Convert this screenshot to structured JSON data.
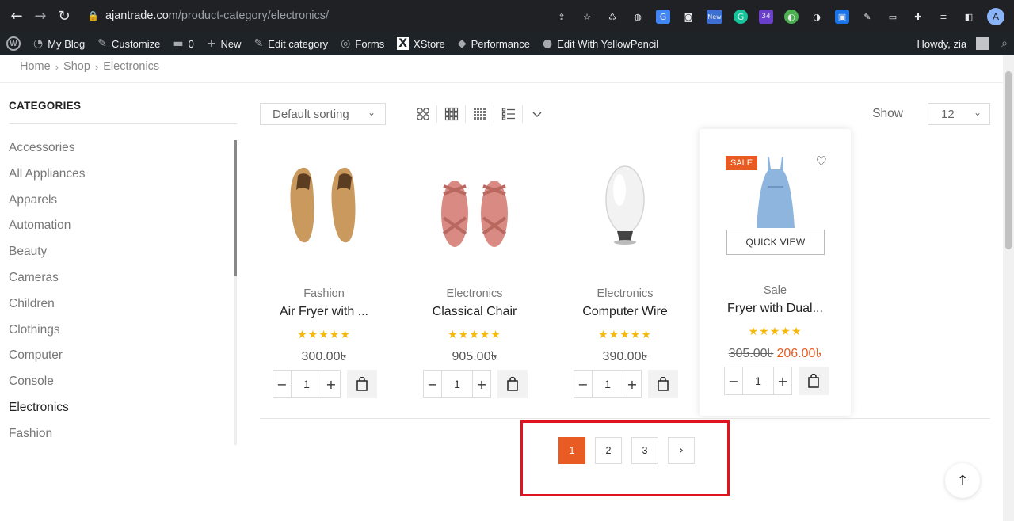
{
  "browser": {
    "url_domain": "ajantrade.com",
    "url_path": "/product-category/electronics/",
    "avatar_letter": "A",
    "ext_badge_new": "New",
    "ext_badge_count": "34"
  },
  "adminbar": {
    "my_blog": "My Blog",
    "customize": "Customize",
    "comments_count": "0",
    "new": "New",
    "edit_category": "Edit category",
    "forms": "Forms",
    "xstore": "XStore",
    "performance": "Performance",
    "edit_yellowpencil": "Edit With YellowPencil",
    "howdy": "Howdy, zia"
  },
  "breadcrumb": [
    "Home",
    "Shop",
    "Electronics"
  ],
  "sidebar": {
    "title": "CATEGORIES",
    "items": [
      "Accessories",
      "All Appliances",
      "Apparels",
      "Automation",
      "Beauty",
      "Cameras",
      "Children",
      "Clothings",
      "Computer",
      "Console",
      "Electronics",
      "Fashion"
    ],
    "active": "Electronics"
  },
  "toolbar": {
    "sort_value": "Default sorting",
    "show_label": "Show",
    "show_value": "12"
  },
  "products": [
    {
      "category": "Fashion",
      "title": "Air Fryer with ...",
      "stars": "★★★★★",
      "price": "300.00৳",
      "qty": "1"
    },
    {
      "category": "Electronics",
      "title": "Classical Chair",
      "stars": "★★★★★",
      "price": "905.00৳",
      "qty": "1"
    },
    {
      "category": "Electronics",
      "title": "Computer Wire",
      "stars": "★★★★★",
      "price": "390.00৳",
      "qty": "1"
    },
    {
      "category": "Sale",
      "title": "Fryer with Dual...",
      "stars": "★★★★★",
      "old_price": "305.00৳",
      "price": "206.00৳",
      "qty": "1",
      "badge": "SALE",
      "quick_view": "QUICK VIEW"
    }
  ],
  "pagination": {
    "pages": [
      "1",
      "2",
      "3"
    ],
    "current": "1"
  },
  "colors": {
    "accent": "#e85c24",
    "star": "#f6b80b",
    "highlight": "#e0141e"
  }
}
